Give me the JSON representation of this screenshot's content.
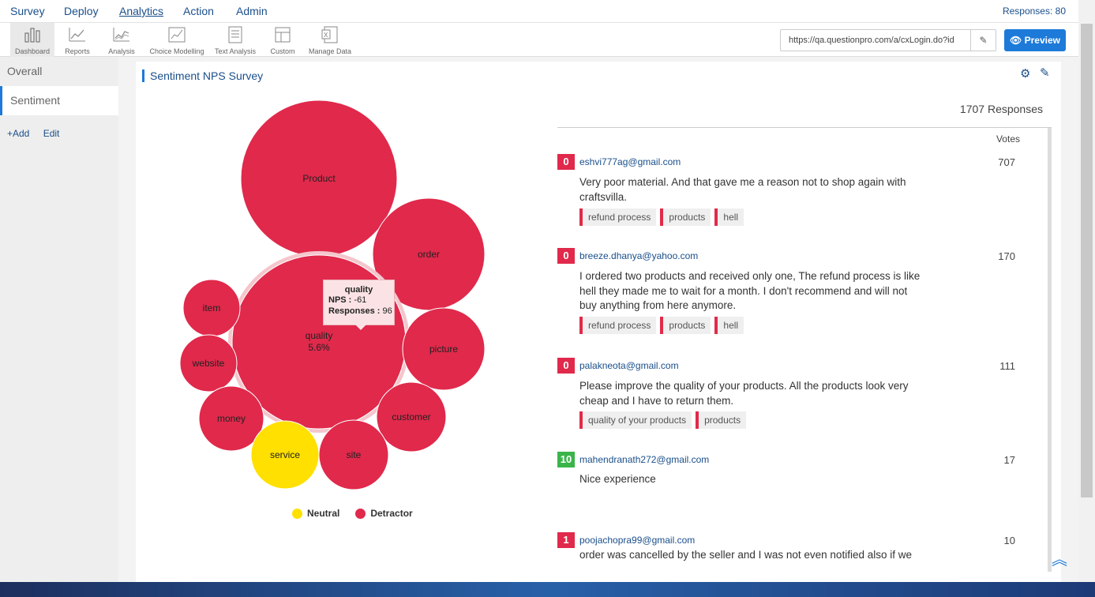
{
  "topnav": {
    "items": [
      "Survey",
      "Deploy",
      "Analytics",
      "Action",
      "Admin"
    ],
    "active": "Analytics",
    "responses": "Responses: 80"
  },
  "toolbar": {
    "tools": [
      {
        "label": "Dashboard",
        "icon": "dashboard-icon"
      },
      {
        "label": "Reports",
        "icon": "reports-icon"
      },
      {
        "label": "Analysis",
        "icon": "analysis-icon"
      },
      {
        "label": "Choice Modelling",
        "icon": "choice-modelling-icon"
      },
      {
        "label": "Text Analysis",
        "icon": "text-analysis-icon"
      },
      {
        "label": "Custom",
        "icon": "custom-icon"
      },
      {
        "label": "Manage Data",
        "icon": "manage-data-icon"
      }
    ],
    "url": "https://qa.questionpro.com/a/cxLogin.do?id",
    "preview_label": "Preview"
  },
  "sidebar": {
    "items": [
      "Overall",
      "Sentiment"
    ],
    "active": "Sentiment",
    "add_label": "+Add",
    "edit_label": "Edit"
  },
  "panel": {
    "title": "Sentiment NPS Survey",
    "responses_count": "1707 Responses",
    "votes_header": "Votes"
  },
  "chart_data": {
    "type": "bubble",
    "bubbles": [
      {
        "label": "Product",
        "category": "Detractor"
      },
      {
        "label": "order",
        "category": "Detractor"
      },
      {
        "label": "quality",
        "sub": "5.6%",
        "category": "Detractor"
      },
      {
        "label": "item",
        "category": "Detractor"
      },
      {
        "label": "website",
        "category": "Detractor"
      },
      {
        "label": "picture",
        "category": "Detractor"
      },
      {
        "label": "money",
        "category": "Detractor"
      },
      {
        "label": "customer",
        "category": "Detractor"
      },
      {
        "label": "service",
        "category": "Neutral"
      },
      {
        "label": "site",
        "category": "Detractor"
      }
    ],
    "legend": [
      {
        "name": "Neutral",
        "color": "#ffe000"
      },
      {
        "name": "Detractor",
        "color": "#e0294b"
      }
    ],
    "tooltip": {
      "title": "quality",
      "nps_label": "NPS :",
      "nps": "-61",
      "responses_label": "Responses :",
      "responses": "96"
    }
  },
  "responses": [
    {
      "score": "0",
      "score_color": "#e0294b",
      "email": "eshvi777ag@gmail.com",
      "votes": "707",
      "text": "Very poor material. And that gave me a reason not to shop again with craftsvilla.",
      "tags": [
        "refund process",
        "products",
        "hell"
      ]
    },
    {
      "score": "0",
      "score_color": "#e0294b",
      "email": "breeze.dhanya@yahoo.com",
      "votes": "170",
      "text": "I ordered two products and received only one, The refund process is like hell they made me to wait for a month. I don't recommend and will not buy anything from here anymore.",
      "tags": [
        "refund process",
        "products",
        "hell"
      ]
    },
    {
      "score": "0",
      "score_color": "#e0294b",
      "email": "palakneota@gmail.com",
      "votes": "111",
      "text": "Please improve the quality of your products. All the products look very cheap and I have to return them.",
      "tags": [
        "quality of your products",
        "products"
      ]
    },
    {
      "score": "10",
      "score_color": "#3ab54a",
      "email": "mahendranath272@gmail.com",
      "votes": "17",
      "text": "Nice experience",
      "tags": []
    },
    {
      "score": "1",
      "score_color": "#e0294b",
      "email": "poojachopra99@gmail.com",
      "votes": "10",
      "text": "order was cancelled by the seller and I was not even notified also if we",
      "tags": []
    }
  ]
}
